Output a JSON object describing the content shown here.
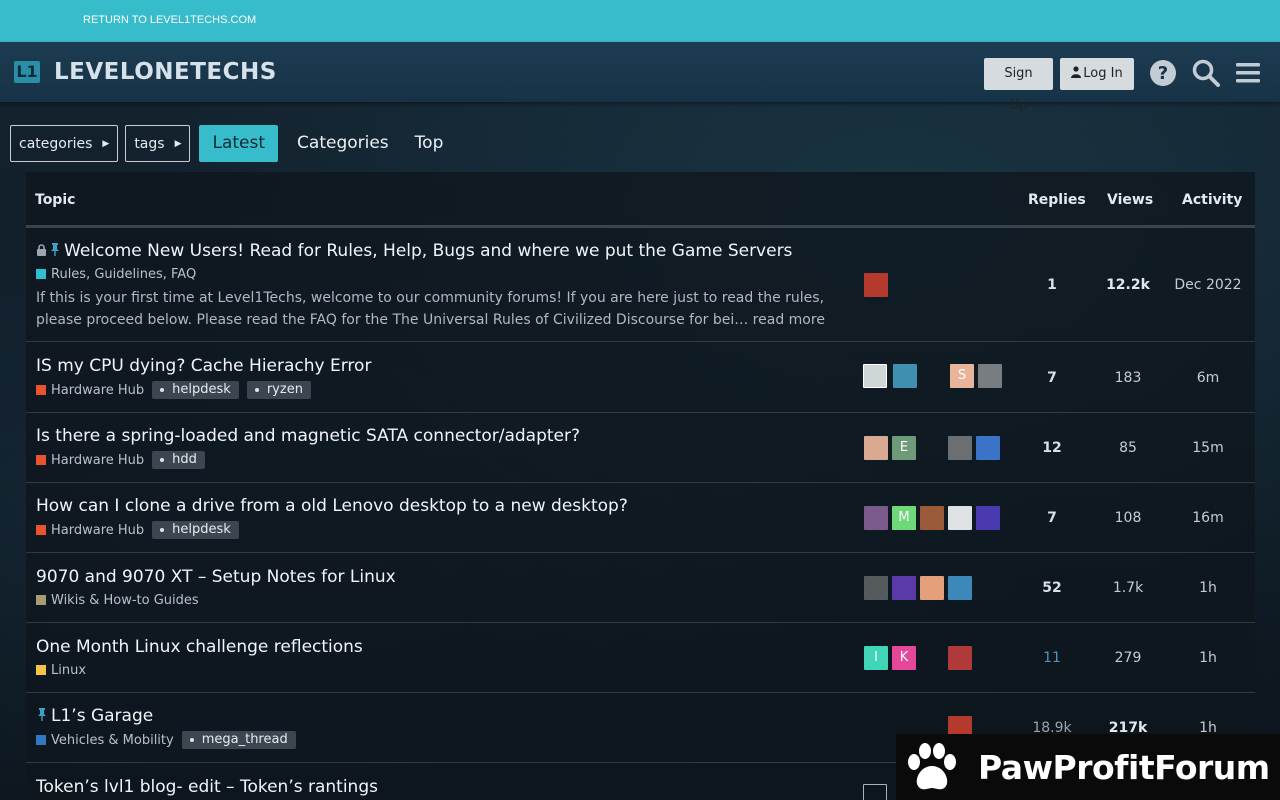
{
  "return_bar": {
    "link": "RETURN TO LEVEL1TECHS.COM"
  },
  "header": {
    "logo_mark": "L1",
    "logo_text": "LEVELONETECHS",
    "signup": "Sign Up",
    "login": "Log In",
    "icons": [
      "help-icon",
      "search-icon",
      "hamburger-icon"
    ]
  },
  "nav": {
    "categories_dd": "categories",
    "tags_dd": "tags",
    "links": [
      "Latest",
      "Categories",
      "Top"
    ],
    "active": "Latest"
  },
  "table": {
    "headers": {
      "topic": "Topic",
      "replies": "Replies",
      "views": "Views",
      "activity": "Activity"
    },
    "rows": [
      {
        "title": "Welcome New Users! Read for Rules, Help, Bugs and where we put the Game Servers",
        "locked": true,
        "pinned": true,
        "category": "Rules, Guidelines, FAQ",
        "category_color": "#2ebfd0",
        "tags": [],
        "excerpt": "If this is your first time at Level1Techs, welcome to our community forums! If you are here just to read the rules, please proceed below. Please read the FAQ for the The Universal Rules of Civilized Discourse for bei… read more",
        "replies": "1",
        "views": "12.2k",
        "activity": "Dec 2022"
      },
      {
        "title": "IS my CPU dying? Cache Hierachy Error",
        "category": "Hardware Hub",
        "category_color": "#e8542d",
        "tags": [
          "helpdesk",
          "ryzen"
        ],
        "avatar_letters": [
          "",
          "",
          "S",
          ""
        ],
        "replies": "7",
        "views": "183",
        "activity": "6m"
      },
      {
        "title": "Is there a spring-loaded and magnetic SATA connector/adapter?",
        "category": "Hardware Hub",
        "category_color": "#e8542d",
        "tags": [
          "hdd"
        ],
        "avatar_letters": [
          "",
          "E",
          "",
          ""
        ],
        "replies": "12",
        "views": "85",
        "activity": "15m"
      },
      {
        "title": "How can I clone a drive from a old Lenovo desktop to a new desktop?",
        "category": "Hardware Hub",
        "category_color": "#e8542d",
        "tags": [
          "helpdesk"
        ],
        "avatar_letters": [
          "",
          "M",
          "",
          "",
          ""
        ],
        "replies": "7",
        "views": "108",
        "activity": "16m"
      },
      {
        "title": "9070 and 9070 XT – Setup Notes for Linux",
        "category": "Wikis & How-to Guides",
        "category_color": "#a89b72",
        "tags": [],
        "replies": "52",
        "views": "1.7k",
        "activity": "1h"
      },
      {
        "title": "One Month Linux challenge reflections",
        "category": "Linux",
        "category_color": "#f5c444",
        "tags": [],
        "avatar_letters": [
          "I",
          "K",
          ""
        ],
        "replies": "11",
        "views": "279",
        "activity": "1h"
      },
      {
        "title": "L1’s Garage",
        "pinned": true,
        "category": "Vehicles & Mobility",
        "category_color": "#2f79c4",
        "tags": [
          "mega_thread"
        ],
        "replies": "18.9k",
        "views": "217k",
        "activity": "1h"
      },
      {
        "title": "Token’s lvl1 blog- edit – Token’s rantings"
      }
    ]
  },
  "watermark": {
    "text": "PawProfitForum"
  }
}
